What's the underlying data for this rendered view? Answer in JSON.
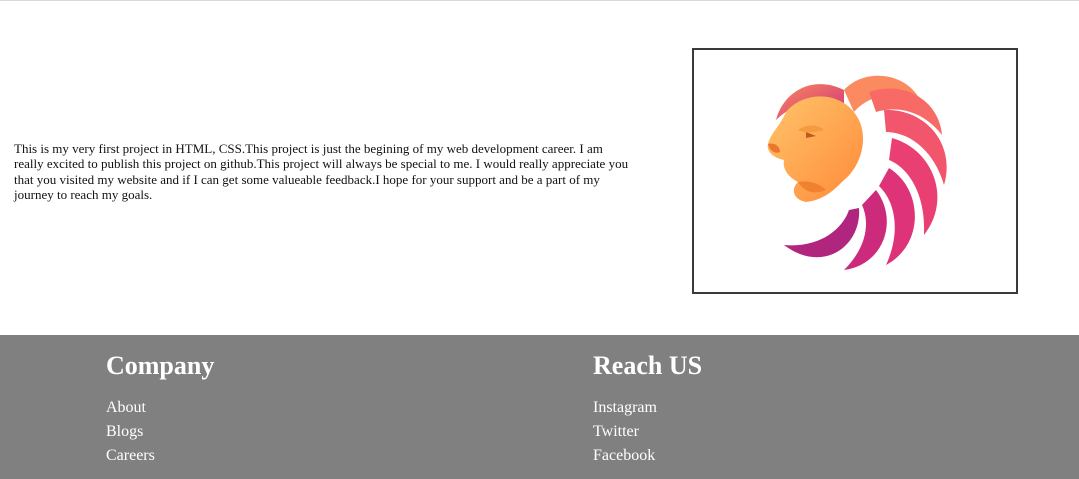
{
  "intro": {
    "text": "This is my very first project in HTML, CSS.This project is just the begining of my web development career. I am really excited to publish this project on github.This project will always be special to me. I would really appreciate you that you visited my website and if I can get some valueable feedback.I hope for your support and be a part of my journey to reach my goals."
  },
  "logo": {
    "icon": "lion-head-icon"
  },
  "footer": {
    "company": {
      "title": "Company",
      "links": [
        "About",
        "Blogs",
        "Careers"
      ]
    },
    "reach": {
      "title": "Reach US",
      "links": [
        "Instagram",
        "Twitter",
        "Facebook"
      ]
    }
  }
}
